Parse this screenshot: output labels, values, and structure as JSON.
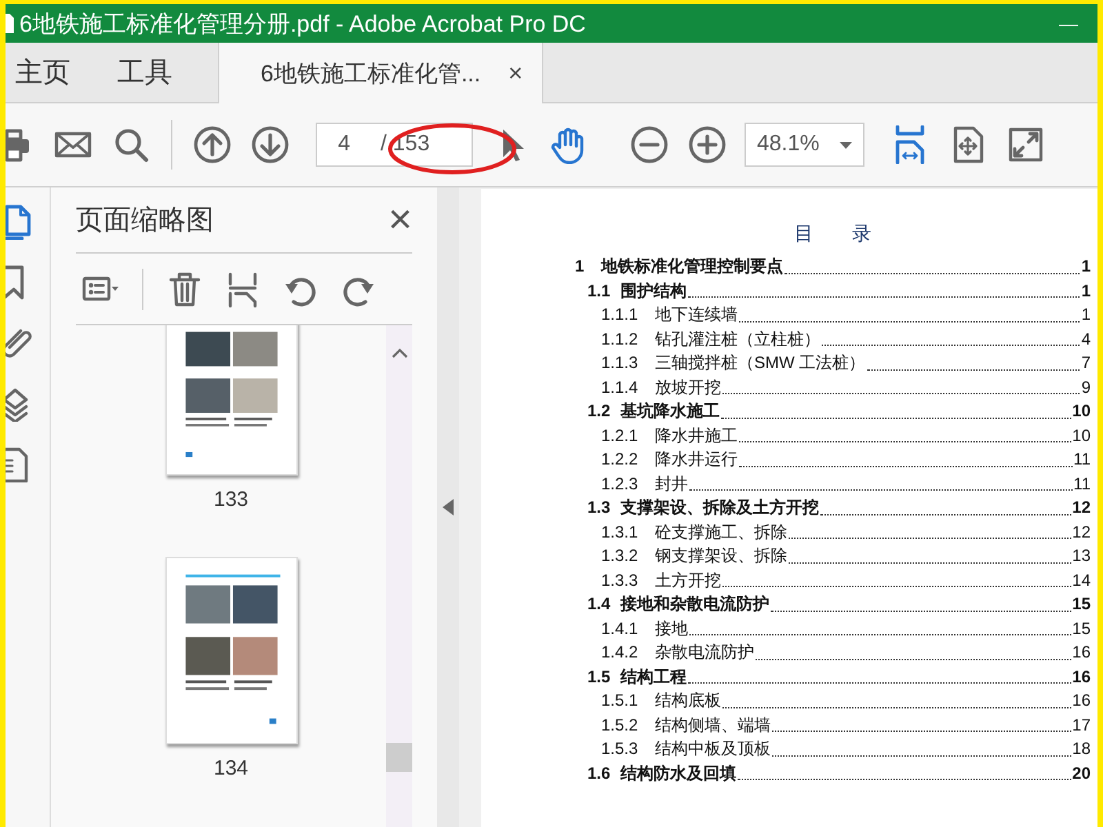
{
  "window": {
    "title": "6地铁施工标准化管理分册.pdf - Adobe Acrobat Pro DC",
    "minimize": "—"
  },
  "tabs": [
    {
      "label": "主页",
      "selected": false
    },
    {
      "label": "工具",
      "selected": false
    },
    {
      "label": "6地铁施工标准化管...",
      "selected": true,
      "close": "×"
    }
  ],
  "toolbar": {
    "page_number": "4",
    "page_total": "/ 153",
    "zoom": "48.1%",
    "hand_tool_on": true,
    "fit_width_on": true
  },
  "side_rail": [
    {
      "kind": "page",
      "selected": true
    },
    {
      "kind": "bookmark",
      "selected": false
    },
    {
      "kind": "clip",
      "selected": false
    },
    {
      "kind": "layers",
      "selected": false
    },
    {
      "kind": "doc",
      "selected": false
    }
  ],
  "thumbnails_panel": {
    "title": "页面缩略图",
    "close": "×",
    "thumbnails": [
      {
        "label": "133",
        "cut": true
      },
      {
        "label": "134",
        "cut": false
      }
    ]
  },
  "document": {
    "heading": "目　　录",
    "toc": [
      {
        "number": "1",
        "title": "地铁标准化管理控制要点",
        "page": "1",
        "children": [
          {
            "number": "1.1",
            "title": "围护结构",
            "page": "1",
            "children": [
              {
                "number": "1.1.1",
                "title": "地下连续墙",
                "page": "1"
              },
              {
                "number": "1.1.2",
                "title": "钻孔灌注桩（立柱桩）",
                "page": "4"
              },
              {
                "number": "1.1.3",
                "title": "三轴搅拌桩（SMW 工法桩）",
                "page": "7"
              },
              {
                "number": "1.1.4",
                "title": "放坡开挖",
                "page": "9"
              }
            ]
          },
          {
            "number": "1.2",
            "title": "基坑降水施工",
            "page": "10",
            "children": [
              {
                "number": "1.2.1",
                "title": "降水井施工",
                "page": "10"
              },
              {
                "number": "1.2.2",
                "title": "降水井运行",
                "page": "11"
              },
              {
                "number": "1.2.3",
                "title": "封井",
                "page": "11"
              }
            ]
          },
          {
            "number": "1.3",
            "title": "支撑架设、拆除及土方开挖",
            "page": "12",
            "children": [
              {
                "number": "1.3.1",
                "title": "砼支撑施工、拆除",
                "page": "12"
              },
              {
                "number": "1.3.2",
                "title": "钢支撑架设、拆除",
                "page": "13"
              },
              {
                "number": "1.3.3",
                "title": "土方开挖",
                "page": "14"
              }
            ]
          },
          {
            "number": "1.4",
            "title": "接地和杂散电流防护",
            "page": "15",
            "children": [
              {
                "number": "1.4.1",
                "title": "接地",
                "page": "15"
              },
              {
                "number": "1.4.2",
                "title": "杂散电流防护",
                "page": "16"
              }
            ]
          },
          {
            "number": "1.5",
            "title": "结构工程",
            "page": "16",
            "children": [
              {
                "number": "1.5.1",
                "title": "结构底板",
                "page": "16"
              },
              {
                "number": "1.5.2",
                "title": "结构侧墙、端墙",
                "page": "17"
              },
              {
                "number": "1.5.3",
                "title": "结构中板及顶板",
                "page": "18"
              }
            ]
          },
          {
            "number": "1.6",
            "title": "结构防水及回填",
            "page": "20"
          }
        ]
      }
    ]
  }
}
